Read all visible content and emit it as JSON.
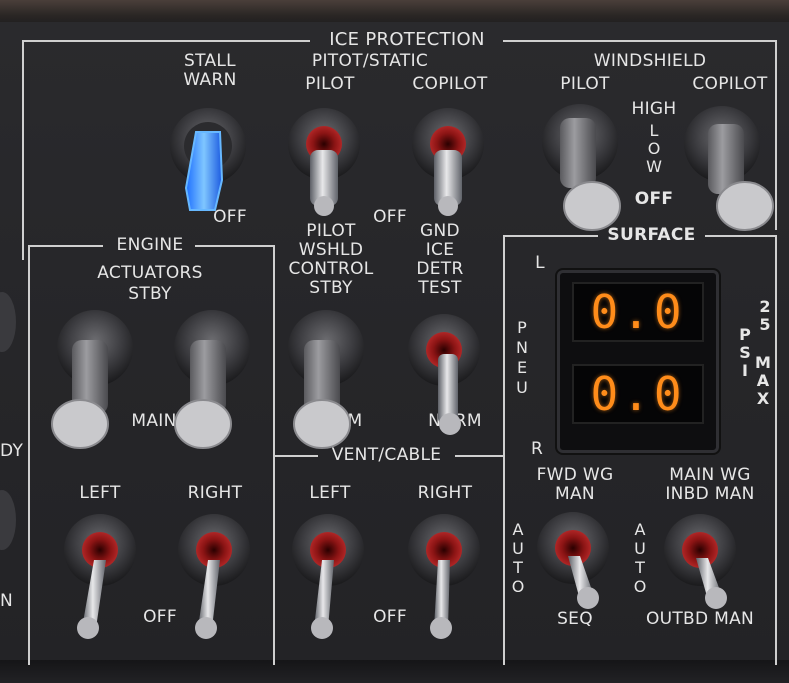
{
  "panel": {
    "title": "ICE PROTECTION",
    "stall_warn_label": "STALL\nWARN",
    "pitot_static_label": "PITOT/STATIC",
    "pitot_pilot_label": "PILOT",
    "pitot_copilot_label": "COPILOT",
    "windshield_label": "WINDSHIELD",
    "windshield_pilot_label": "PILOT",
    "windshield_copilot_label": "COPILOT",
    "high_label": "HIGH",
    "low_label": "LOW",
    "off_label": "OFF",
    "off_small": "OFF",
    "stall_off": "OFF",
    "engine_label": "ENGINE",
    "actuators_label": "ACTUATORS",
    "stby_label": "STBY",
    "main_label": "MAIN",
    "pilot_wshld_label": "PILOT\nWSHLD\nCONTROL\nSTBY",
    "gnd_ice_label": "GND\nICE\nDETR\nTEST",
    "norm_partial_1": "M",
    "norm_partial_2": "NORM",
    "vent_cable_label": "VENT/CABLE",
    "left_label_1": "LEFT",
    "right_label_1": "RIGHT",
    "left_label_2": "LEFT",
    "right_label_2": "RIGHT",
    "off_label_2": "OFF",
    "off_label_3": "OFF",
    "surface_label": "SURFACE",
    "l_label": "L",
    "r_label": "R",
    "pneu_label": "PNEU",
    "psi_label": "PSI",
    "max_label": "MAX",
    "max_value": "25",
    "upper_reading": "0.0",
    "lower_reading": "0.0",
    "fwd_wg_label": "FWD WG\nMAN",
    "main_wg_label": "MAIN WG\nINBD MAN",
    "auto_label_1": "AUTO",
    "auto_label_2": "AUTO",
    "seq_label": "SEQ",
    "outbd_man_label": "OUTBD MAN",
    "left_edge_1": "DY",
    "left_edge_2": "N"
  },
  "colors": {
    "display_digits": "#ff8c1a",
    "stall_lever": "#2f8cff",
    "guard_red": "#9b1c1c"
  }
}
